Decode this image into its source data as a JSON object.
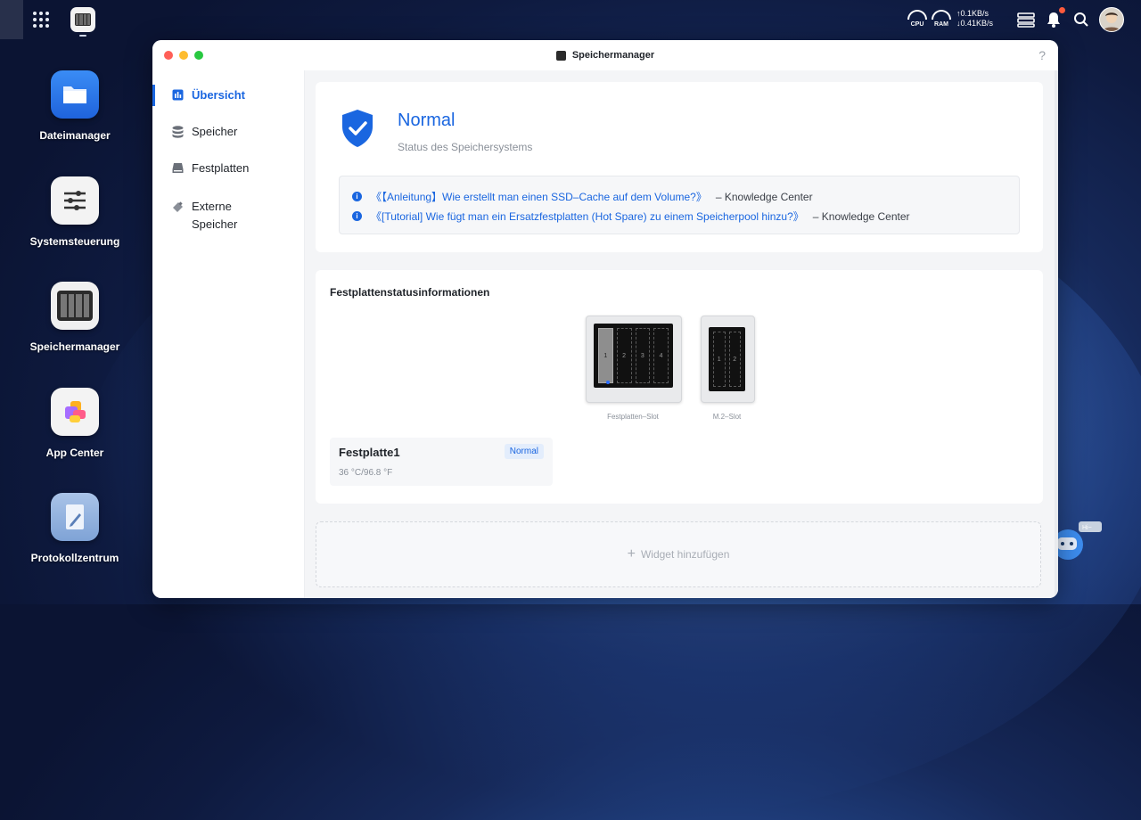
{
  "topbar": {
    "net_up": "↑0.1KB/s",
    "net_down": "↓0.41KB/s",
    "cpu_label": "CPU",
    "ram_label": "RAM"
  },
  "desktop": {
    "items": [
      {
        "label": "Dateimanager",
        "icon": "folder-icon"
      },
      {
        "label": "Systemsteuerung",
        "icon": "sliders-icon"
      },
      {
        "label": "Speichermanager",
        "icon": "storage-icon"
      },
      {
        "label": "App Center",
        "icon": "app-center-icon"
      },
      {
        "label": "Protokollzentrum",
        "icon": "log-icon"
      }
    ]
  },
  "window": {
    "title": "Speichermanager",
    "help": "?"
  },
  "sidebar": {
    "items": [
      {
        "label": "Übersicht",
        "icon": "overview-icon"
      },
      {
        "label": "Speicher",
        "icon": "database-icon"
      },
      {
        "label": "Festplatten",
        "icon": "disk-icon"
      },
      {
        "label": "Externe",
        "label2": "Speicher",
        "icon": "usb-icon"
      }
    ]
  },
  "status": {
    "title": "Normal",
    "subtitle": "Status des Speichersystems",
    "links": [
      {
        "text": "《【Anleitung】Wie erstellt man einen SSD–Cache auf dem Volume?》",
        "source": "– Knowledge Center"
      },
      {
        "text": "《[Tutorial] Wie fügt man ein Ersatzfestplatten (Hot Spare) zu einem Speicherpool hinzu?》",
        "source": "– Knowledge Center"
      }
    ]
  },
  "disk_status": {
    "title": "Festplattenstatusinformationen",
    "bays": [
      {
        "label": "Festplatten–Slot",
        "slots": [
          "1",
          "2",
          "3",
          "4"
        ]
      },
      {
        "label": "M.2–Slot",
        "slots": [
          "1",
          "2"
        ]
      }
    ],
    "disk": {
      "name": "Festplatte1",
      "badge": "Normal",
      "temp": "36 °C/96.8 °F"
    }
  },
  "widget": {
    "add_label": "Widget hinzufügen",
    "plus": "+"
  },
  "colors": {
    "accent": "#1a66e0"
  }
}
